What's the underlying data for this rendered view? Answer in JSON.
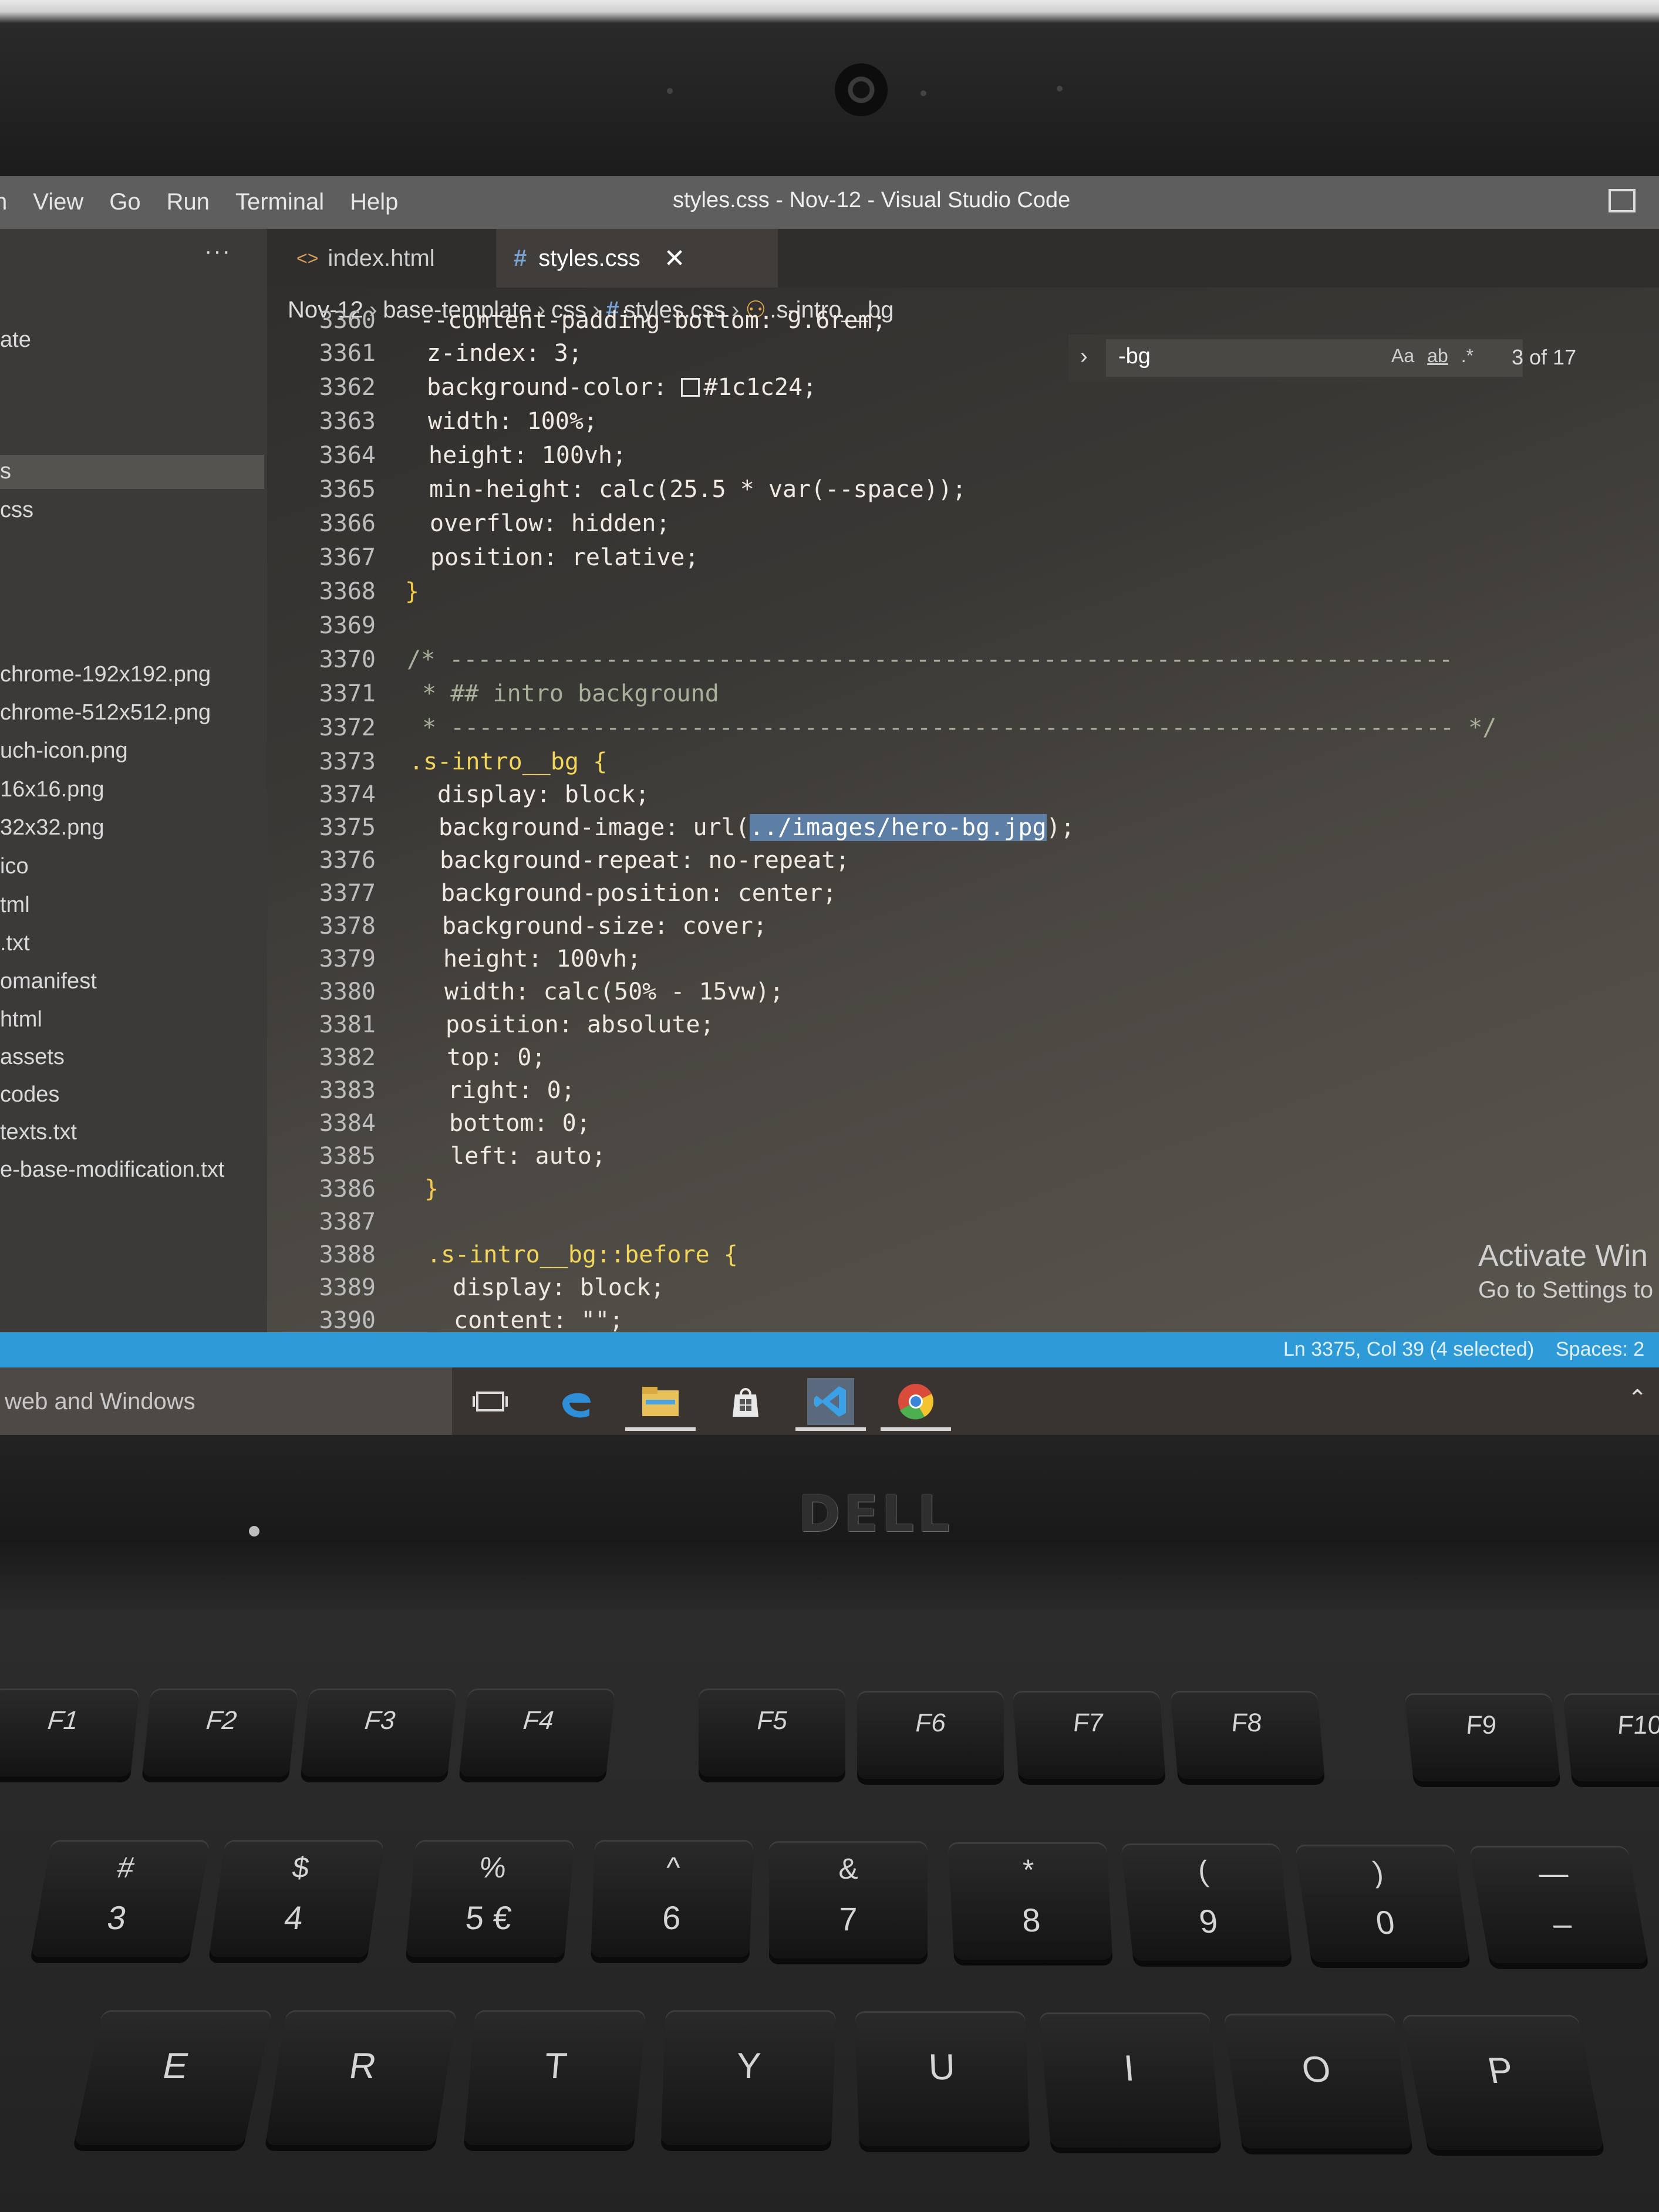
{
  "window": {
    "title": "styles.css - Nov-12 - Visual Studio Code"
  },
  "menu": [
    "n",
    "View",
    "Go",
    "Run",
    "Terminal",
    "Help"
  ],
  "sidebar": {
    "more": "···",
    "items": [
      {
        "label": "ate",
        "top": 0
      },
      {
        "label": "s"
      },
      {
        "label": "css"
      },
      {
        "label": "chrome-192x192.png"
      },
      {
        "label": "chrome-512x512.png"
      },
      {
        "label": "uch-icon.png"
      },
      {
        "label": "16x16.png"
      },
      {
        "label": "32x32.png"
      },
      {
        "label": "ico"
      },
      {
        "label": "tml"
      },
      {
        "label": ".txt"
      },
      {
        "label": "omanifest"
      },
      {
        "label": "html"
      },
      {
        "label": "assets"
      },
      {
        "label": "codes"
      },
      {
        "label": "texts.txt"
      },
      {
        "label": "e-base-modification.txt"
      }
    ]
  },
  "tabs": [
    {
      "icon": "<>",
      "label": "index.html"
    },
    {
      "icon": "#",
      "label": "styles.css",
      "close": "✕"
    }
  ],
  "breadcrumb": [
    "Nov-12",
    "base-template",
    "css",
    "styles.css",
    ".s-intro__bg"
  ],
  "find": {
    "value": "-bg",
    "opt_case": "Aa",
    "opt_word": "ab",
    "opt_regex": ".*",
    "count": "3 of 17"
  },
  "editor": {
    "line_numbers": [
      "3360",
      "3361",
      "3362",
      "3363",
      "3364",
      "3365",
      "3366",
      "3367",
      "3368",
      "3369",
      "3370",
      "3371",
      "3372",
      "3373",
      "3374",
      "3375",
      "3376",
      "3377",
      "3378",
      "3379",
      "3380",
      "3381",
      "3382",
      "3383",
      "3384",
      "3385",
      "3386",
      "3387",
      "3388",
      "3389",
      "3390"
    ],
    "lines": [
      "--content-padding-bottom: 9.6rem;",
      "z-index: 3;",
      "background-color: ",
      "width: 100%;",
      "height: 100vh;",
      "min-height: calc(25.5 * var(--space));",
      "overflow: hidden;",
      "position: relative;",
      "}",
      "",
      "/* -----------------------------------------------------------------------",
      " * ## intro background",
      " * ----------------------------------------------------------------------- */",
      ".s-intro__bg {",
      "display: block;",
      "background-image: url(",
      "background-repeat: no-repeat;",
      "background-position: center;",
      "background-size: cover;",
      "height: 100vh;",
      "width: calc(50% - 15vw);",
      "position: absolute;",
      "top: 0;",
      "right: 0;",
      "bottom: 0;",
      "left: auto;",
      "}",
      "",
      ".s-intro__bg::before {",
      "display: block;",
      "content: \"\";"
    ],
    "color_value": "#1c1c24",
    "url_selected": "../images/hero-bg.jpg",
    "url_end": ");"
  },
  "status": {
    "position": "Ln 3375, Col 39 (4 selected)",
    "spaces": "Spaces: 2"
  },
  "watermark": {
    "line1": "Activate Win",
    "line2": "Go to Settings to"
  },
  "taskbar": {
    "search": "web and Windows"
  },
  "laptop": {
    "brand": "DELL"
  },
  "keyboard": {
    "fkeys": [
      "F1",
      "F2",
      "F3",
      "F4",
      "F5",
      "F6",
      "F7",
      "F8",
      "F9",
      "F10"
    ],
    "numkeys": [
      {
        "top": "#",
        "bottom": "3"
      },
      {
        "top": "$",
        "bottom": "4"
      },
      {
        "top": "%",
        "bottom": "5 €"
      },
      {
        "top": "^",
        "bottom": "6"
      },
      {
        "top": "&",
        "bottom": "7"
      },
      {
        "top": "*",
        "bottom": "8"
      },
      {
        "top": "(",
        "bottom": "9"
      },
      {
        "top": ")",
        "bottom": "0"
      },
      {
        "top": "—",
        "bottom": "–"
      }
    ],
    "letters": [
      "E",
      "R",
      "T",
      "Y",
      "U",
      "I",
      "O",
      "P"
    ]
  },
  "colors": {
    "statusbar": "#2e9ad8",
    "selection": "#5d7fa6",
    "brace": "#f3c94a"
  }
}
